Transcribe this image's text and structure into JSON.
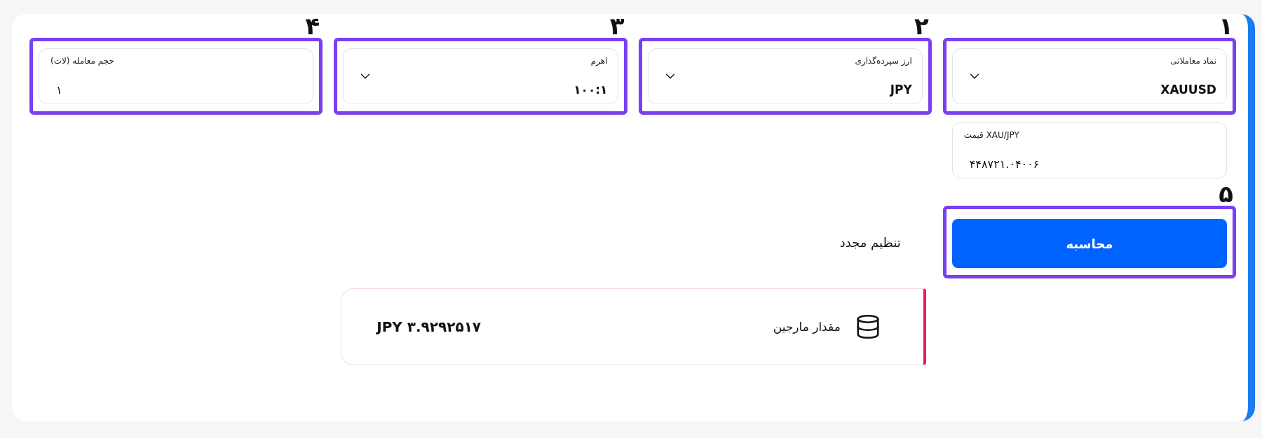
{
  "fields": [
    {
      "kind": "select",
      "label": "نماد معاملاتی",
      "value": "XAUUSD",
      "marker": "۱",
      "highlighted": true
    },
    {
      "kind": "select",
      "label": "ارز سپرده‌گذاری",
      "value": "JPY",
      "marker": "۲",
      "highlighted": true
    },
    {
      "kind": "select",
      "label": "اهرم",
      "value": "۱۰۰:۱",
      "marker": "۳",
      "highlighted": true
    },
    {
      "kind": "input",
      "label": "حجم معامله (لات)",
      "value": "۱",
      "marker": "۴",
      "highlighted": true
    }
  ],
  "price_field": {
    "kind": "input",
    "label": "قیمت XAU/JPY",
    "value": "۴۴۸۷۲۱.۰۴۰۰۶",
    "highlighted": false
  },
  "calculate_button": {
    "label": "محاسبه",
    "marker": "۵",
    "highlighted": true
  },
  "reset_button": {
    "label": "تنظیم مجدد"
  },
  "result": {
    "label": "مقدار مارجین",
    "value": "JPY ۳.۹۲۹۲۵۱۷"
  }
}
